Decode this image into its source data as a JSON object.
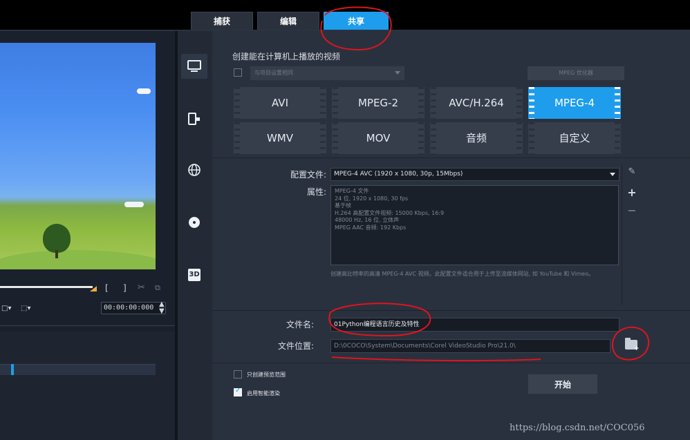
{
  "tabs": [
    {
      "label": "捕获",
      "active": false
    },
    {
      "label": "编辑",
      "active": false
    },
    {
      "label": "共享",
      "active": true
    }
  ],
  "preview": {
    "timecode": "00:00:00:000",
    "controls": {
      "mark_in": "[",
      "mark_out": "]"
    }
  },
  "share_categories": [
    {
      "name": "computer-icon",
      "active": true
    },
    {
      "name": "device-icon",
      "active": false
    },
    {
      "name": "web-globe-icon",
      "active": false
    },
    {
      "name": "disc-icon",
      "active": false
    },
    {
      "name": "3d-icon",
      "active": false,
      "label": "3D"
    }
  ],
  "panel": {
    "title": "创建能在计算机上播放的视频",
    "same_as_project_label": "与项目设置相同",
    "mpeg_optimizer_label": "MPEG 优化器",
    "formats": [
      "AVI",
      "MPEG-2",
      "AVC/H.264",
      "MPEG-4",
      "WMV",
      "MOV",
      "音频",
      "自定义"
    ],
    "selected_format": "MPEG-4",
    "profile_label": "配置文件:",
    "profile_value": "MPEG-4 AVC (1920 x 1080, 30p, 15Mbps)",
    "properties_label": "属性:",
    "properties_lines": [
      "MPEG-4 文件",
      "24 位, 1920 x 1080, 30 fps",
      "基于帧",
      "H.264 高配置文件视频: 15000 Kbps, 16:9",
      "48000 Hz, 16 位, 立体声",
      "MPEG AAC 音频: 192 Kbps"
    ],
    "description": "创建高比特率的高清 MPEG-4 AVC 视频。此配置文件适合用于上传至流媒体网站, 如 YouTube 和 Vimeo。",
    "filename_label": "文件名:",
    "filename_value": "01Python编程语言历史及特性",
    "location_label": "文件位置:",
    "location_value": "D:\\0COCO\\System\\Documents\\Corel VideoStudio Pro\\21.0\\",
    "option_preview_range": "只创建预览范围",
    "option_smart_render": "启用智能渲染",
    "smart_render_checked": true,
    "start_button": "开始"
  },
  "watermark": "https://blog.csdn.net/COC056",
  "colors": {
    "accent": "#1e9ded",
    "annotation": "#e0141e"
  }
}
